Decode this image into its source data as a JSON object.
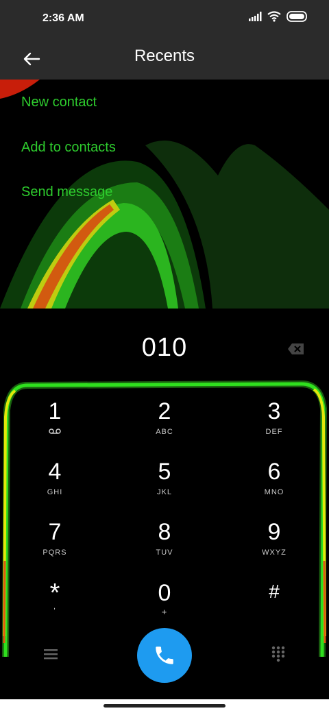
{
  "status": {
    "time": "2:36 AM"
  },
  "header": {
    "title": "Recents"
  },
  "actions": [
    {
      "label": "New contact"
    },
    {
      "label": "Add to contacts"
    },
    {
      "label": "Send message"
    }
  ],
  "dialer": {
    "number": "010",
    "keys": [
      {
        "digit": "1",
        "letters": ""
      },
      {
        "digit": "2",
        "letters": "ABC"
      },
      {
        "digit": "3",
        "letters": "DEF"
      },
      {
        "digit": "4",
        "letters": "GHI"
      },
      {
        "digit": "5",
        "letters": "JKL"
      },
      {
        "digit": "6",
        "letters": "MNO"
      },
      {
        "digit": "7",
        "letters": "PQRS"
      },
      {
        "digit": "8",
        "letters": "TUV"
      },
      {
        "digit": "9",
        "letters": "WXYZ"
      },
      {
        "digit": "*",
        "letters": ","
      },
      {
        "digit": "0",
        "letters": "+"
      },
      {
        "digit": "#",
        "letters": ""
      }
    ]
  },
  "colors": {
    "accent_green": "#2ecc2e",
    "call_blue": "#1e9bf0",
    "bar_bg": "#2b2b2b"
  },
  "icons": [
    "signal-icon",
    "wifi-icon",
    "battery-icon",
    "back-arrow-icon",
    "backspace-icon",
    "voicemail-icon",
    "menu-icon",
    "phone-icon",
    "dialpad-icon"
  ]
}
